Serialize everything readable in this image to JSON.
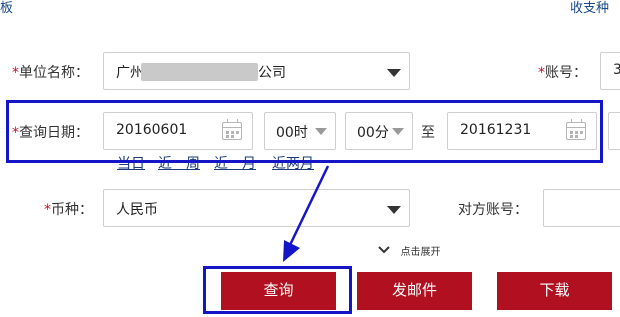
{
  "top": {
    "left_fragment": "板",
    "right_fragment": "收支种"
  },
  "row1": {
    "unit_label": "单位名称：",
    "unit_value_prefix": "广州",
    "unit_value_suffix": "公司",
    "account_label": "账号：",
    "account_value_fragment": "3"
  },
  "row2": {
    "date_label": "查询日期：",
    "start_date": "20160601",
    "start_hour": "00时",
    "start_minute": "00分",
    "to_label": "至",
    "end_date": "20161231"
  },
  "shortcuts": [
    "当日",
    "近一周",
    "近一月",
    "近两月"
  ],
  "row3": {
    "currency_label": "币种：",
    "currency_value": "人民币",
    "counter_account_label": "对方账号："
  },
  "expand": {
    "label": "点击展开"
  },
  "buttons": {
    "query": "查询",
    "email": "发邮件",
    "download": "下载"
  },
  "colors": {
    "primary_button": "#b0101f",
    "annotation": "#1515c8",
    "required_star": "#c8102e",
    "link": "#1a3a7a"
  }
}
